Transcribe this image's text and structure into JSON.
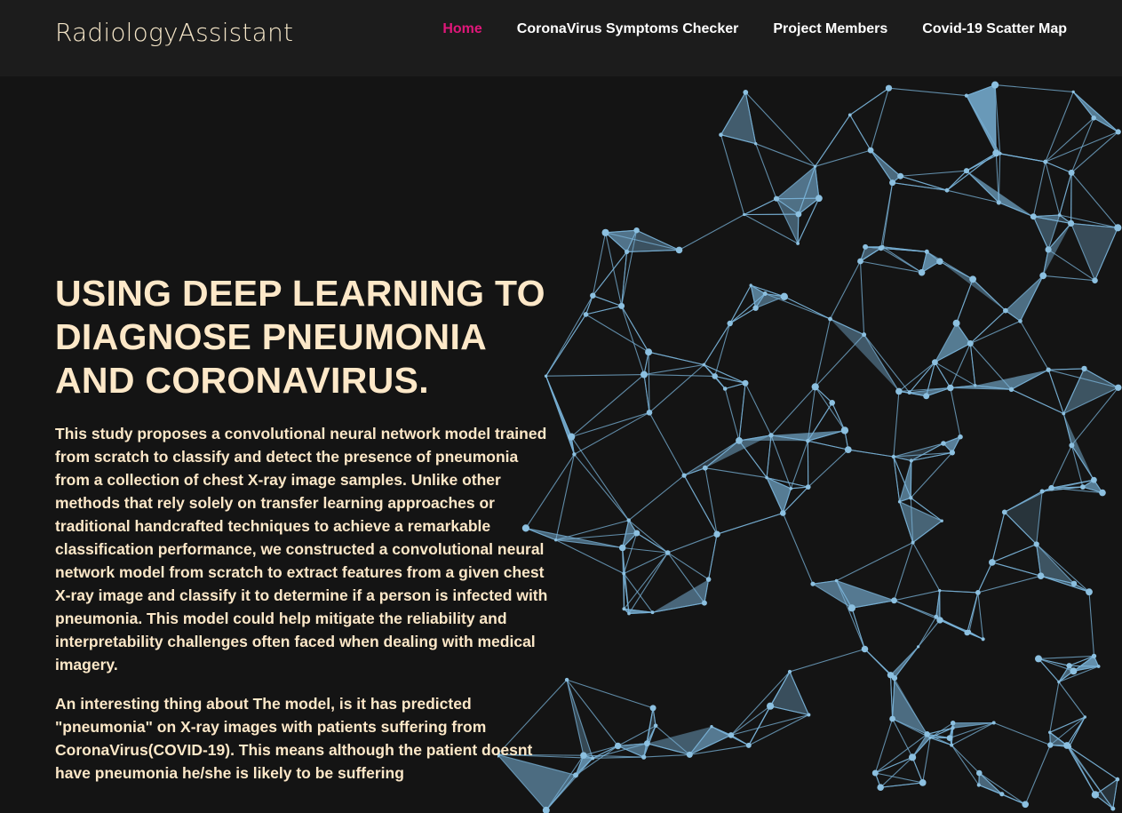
{
  "brand": "RadiologyAssistant",
  "nav": {
    "home": "Home",
    "symptoms": "CoronaVirus Symptoms Checker",
    "members": "Project Members",
    "map": "Covid-19 Scatter Map"
  },
  "colors": {
    "active_nav": "#e0177a",
    "heading_text": "#fde8c8",
    "network": "#7ab3d8",
    "background": "#141414"
  },
  "hero": {
    "title": "USING DEEP LEARNING TO DIAGNOSE PNEUMONIA AND CORONAVIRUS.",
    "paragraph1": "This study proposes a convolutional neural network model trained from scratch to classify and detect the presence of pneumonia from a collection of chest X-ray image samples. Unlike other methods that rely solely on transfer learning approaches or traditional handcrafted techniques to achieve a remarkable classification performance, we constructed a convolutional neural network model from scratch to extract features from a given chest X-ray image and classify it to determine if a person is infected with pneumonia. This model could help mitigate the reliability and interpretability challenges often faced when dealing with medical imagery.",
    "paragraph2": "An interesting thing about The model, is it has predicted \"pneumonia\" on X-ray images with patients suffering from CoronaVirus(COVID-19). This means although the patient doesnt have pneumonia he/she is likely to be suffering"
  }
}
